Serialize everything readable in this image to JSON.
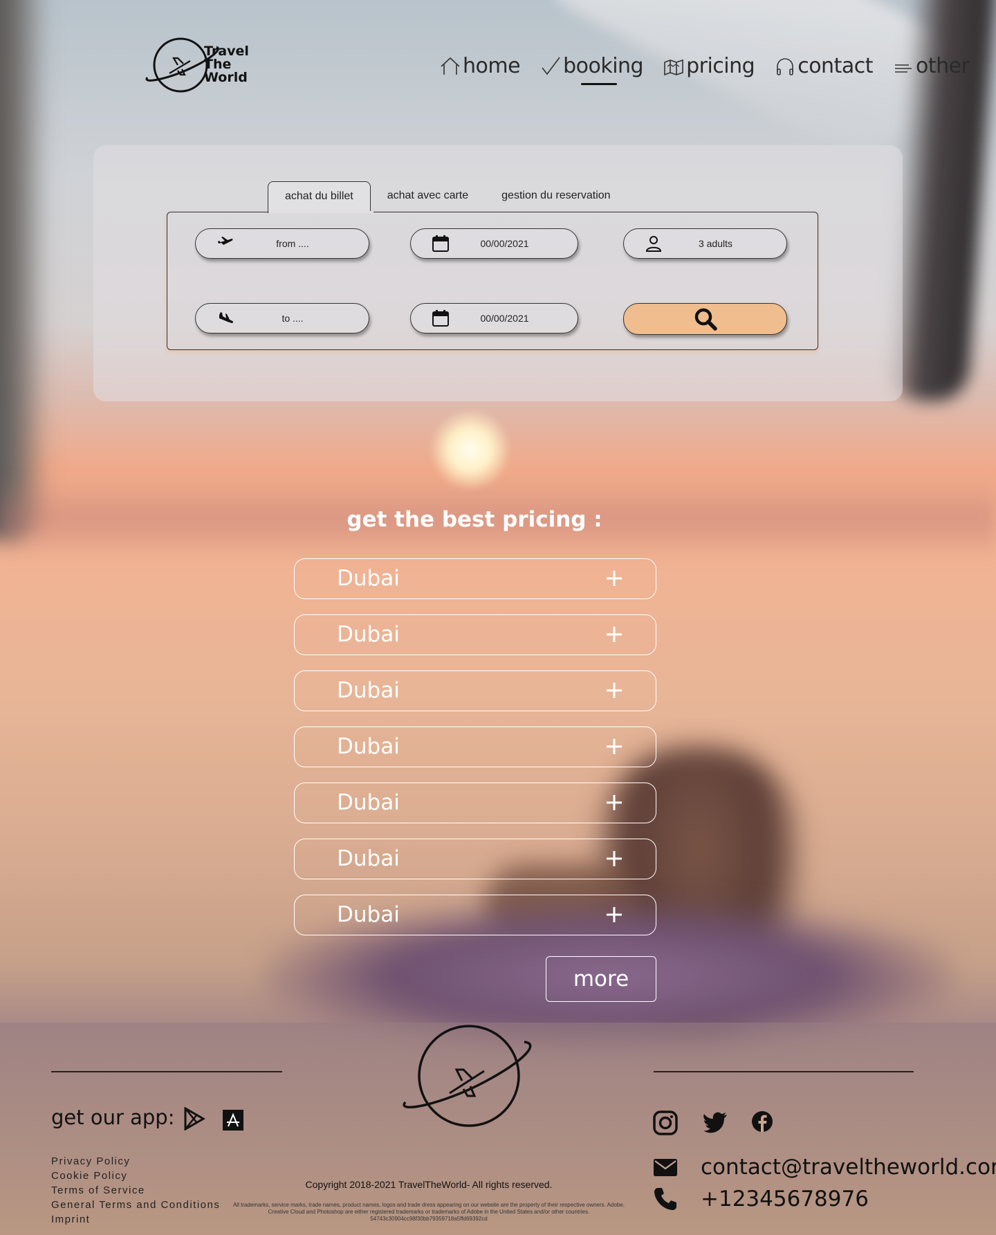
{
  "brand": {
    "logo_lines": [
      "Travel",
      "The",
      "World"
    ]
  },
  "nav": {
    "items": [
      {
        "label": "home",
        "icon": "home-icon"
      },
      {
        "label": "booking",
        "icon": "checkmark-icon",
        "active": true
      },
      {
        "label": "pricing",
        "icon": "map-icon"
      },
      {
        "label": "contact",
        "icon": "headphones-icon"
      },
      {
        "label": "other",
        "icon": "menu-lines-icon"
      }
    ]
  },
  "booking": {
    "tabs": [
      {
        "label": "achat du billet",
        "active": true
      },
      {
        "label": "achat avec carte"
      },
      {
        "label": "gestion du reservation"
      }
    ],
    "from_placeholder": "from ....",
    "to_placeholder": "to ....",
    "depart_date": "00/00/2021",
    "return_date": "00/00/2021",
    "passengers": "3 adults",
    "search_icon": "search-icon"
  },
  "pricing": {
    "title": "get the best pricing :",
    "items": [
      "Dubai",
      "Dubai",
      "Dubai",
      "Dubai",
      "Dubai",
      "Dubai",
      "Dubai"
    ],
    "more_label": "more"
  },
  "footer": {
    "app_label": "get our app:",
    "legal_links": [
      "Privacy Policy",
      "Cookie Policy",
      "Terms of Service",
      "General Terms and Conditions",
      "Imprint"
    ],
    "copyright": "Copyright 2018-2021 TravelTheWorld- All rights reserved.",
    "fine_print": "All trademarks, service marks, trade names, product names, logos and trade dress appearing on our website are the property of their respective owners. Adobe, Creative Cloud and Photoshop are either registered trademarks or trademarks of Adobe in the United States and/or other countries. 54743c30904cc98f30bb79359718a5ffd69392cd",
    "email": "contact@traveltheworld.com",
    "phone": "+12345678976",
    "socials": [
      "instagram-icon",
      "twitter-icon",
      "facebook-icon"
    ]
  },
  "colors": {
    "accent": "#f0bd8e",
    "text_dark": "#111111",
    "text_light": "#ffffff"
  }
}
